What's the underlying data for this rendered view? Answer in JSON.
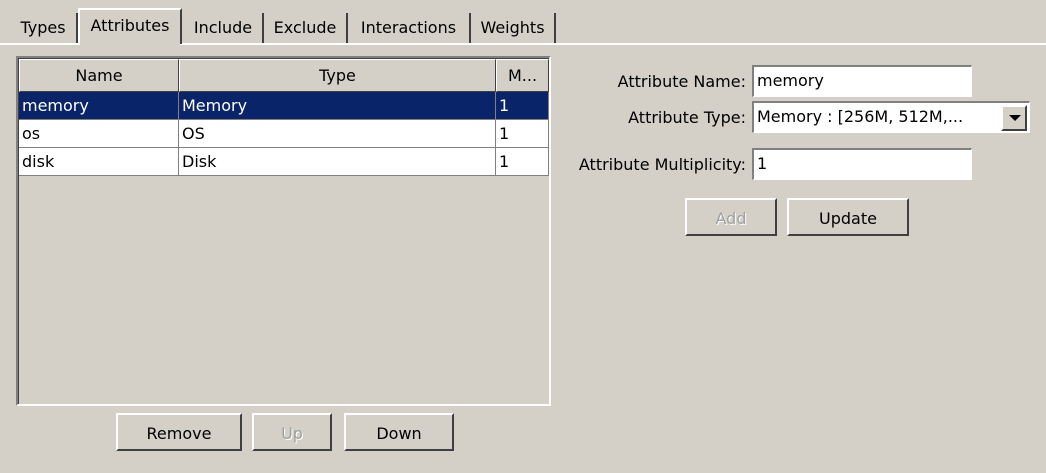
{
  "tabs": [
    {
      "label": "Types"
    },
    {
      "label": "Attributes"
    },
    {
      "label": "Include"
    },
    {
      "label": "Exclude"
    },
    {
      "label": "Interactions"
    },
    {
      "label": "Weights"
    }
  ],
  "table": {
    "columns": [
      "Name",
      "Type",
      "M..."
    ],
    "rows": [
      {
        "name": "memory",
        "type": "Memory",
        "multiplicity": "1"
      },
      {
        "name": "os",
        "type": "OS",
        "multiplicity": "1"
      },
      {
        "name": "disk",
        "type": "Disk",
        "multiplicity": "1"
      }
    ]
  },
  "table_buttons": {
    "remove": "Remove",
    "up": "Up",
    "down": "Down"
  },
  "form": {
    "name_label": "Attribute Name:",
    "name_value": "memory",
    "type_label": "Attribute Type:",
    "type_value": "Memory : [256M, 512M,...",
    "multiplicity_label": "Attribute Multiplicity:",
    "multiplicity_value": "1",
    "add_label": "Add",
    "update_label": "Update"
  }
}
